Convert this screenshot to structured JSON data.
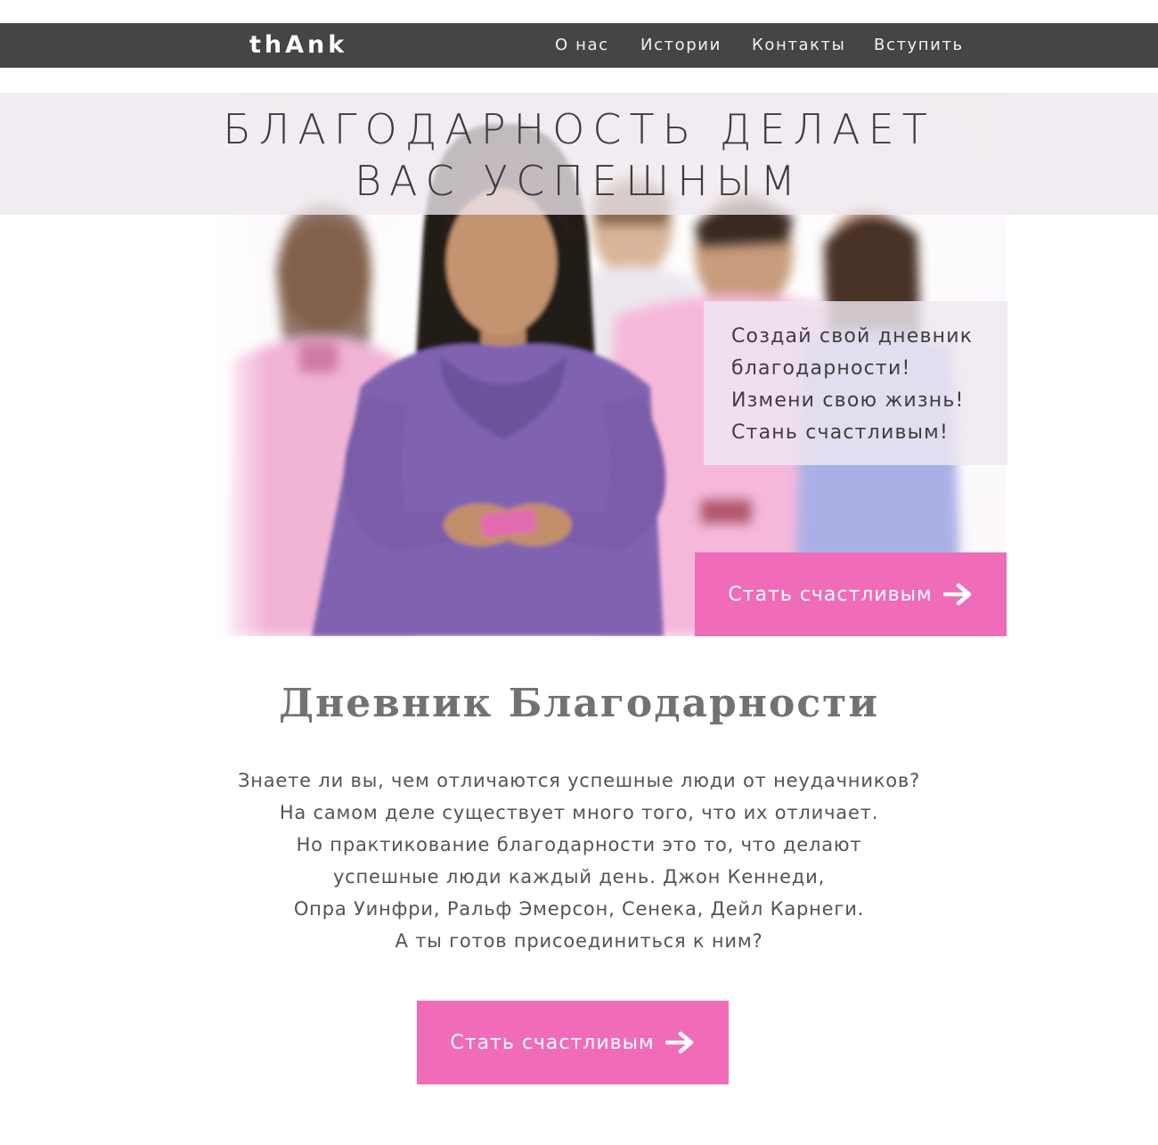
{
  "nav": {
    "logo": "thAnk",
    "links": [
      {
        "label": "О нас"
      },
      {
        "label": "Истории"
      },
      {
        "label": "Контакты"
      },
      {
        "label": "Вступить"
      }
    ]
  },
  "hero": {
    "title_lines": [
      "БЛАГОДАРНОСТЬ ДЕЛАЕТ",
      "ВАС УСПЕШНЫМ"
    ],
    "promo_lines": [
      "Создай свой дневник",
      "благодарности!",
      "Измени свою жизнь!",
      "Стань счастливым!"
    ],
    "cta_label": "Стать счастливым",
    "cta_icon": "arrow-right-icon"
  },
  "content": {
    "title": "Дневник Благодарности",
    "paragraph_lines": [
      "Знаете ли вы, чем отличаются успешные люди от неудачников?",
      "На самом деле существует много того, что их отличает.",
      "Но практикование благодарности это то, что делают",
      "успешные люди каждый день. Джон Кеннеди,",
      "Опра Уинфри, Ральф Эмерсон, Сенека, Дейл Карнеги.",
      "А ты готов присоединиться к ним?"
    ],
    "cta_label": "Стать счастливым",
    "cta_icon": "arrow-right-icon"
  },
  "colors": {
    "nav_bg": "#464446",
    "accent_pink": "#f16cb8",
    "hero_band": "#eee8ee",
    "text_dark": "#3d3b3e"
  }
}
